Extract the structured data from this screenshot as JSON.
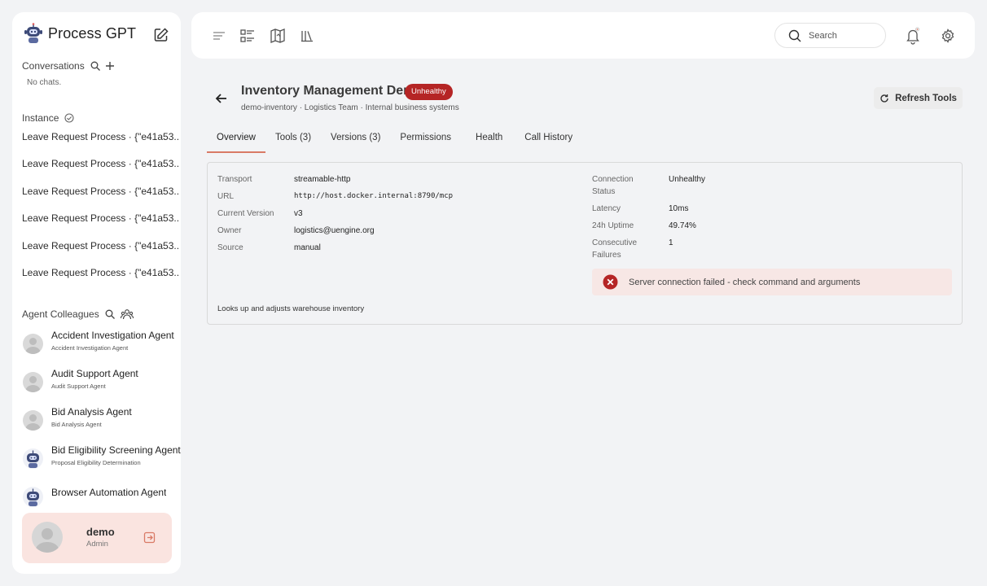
{
  "app": {
    "title": "Process GPT"
  },
  "sidebar": {
    "conversations_label": "Conversations",
    "no_chats": "No chats.",
    "instance_label": "Instance",
    "instances": [
      "Leave Request Process · {\"e41a53...",
      "Leave Request Process · {\"e41a53...",
      "Leave Request Process · {\"e41a53...",
      "Leave Request Process · {\"e41a53...",
      "Leave Request Process · {\"e41a53...",
      "Leave Request Process · {\"e41a53..."
    ],
    "agent_colleagues_label": "Agent Colleagues",
    "agents": [
      {
        "name": "Accident Investigation Agent",
        "sub": "Accident Investigation Agent",
        "avatar": "person"
      },
      {
        "name": "Audit Support Agent",
        "sub": "Audit Support Agent",
        "avatar": "person"
      },
      {
        "name": "Bid Analysis Agent",
        "sub": "Bid Analysis Agent",
        "avatar": "person"
      },
      {
        "name": "Bid Eligibility Screening Agent",
        "sub": "Proposal Eligibility Determination",
        "avatar": "robot"
      },
      {
        "name": "Browser Automation Agent",
        "sub": "",
        "avatar": "robot"
      }
    ],
    "user": {
      "name": "demo",
      "role": "Admin"
    }
  },
  "topbar": {
    "search_placeholder": "Search"
  },
  "server": {
    "name": "Inventory Management Demo",
    "status_badge": "Unhealthy",
    "subline": "demo-inventory · Logistics Team · Internal business systems",
    "refresh_label": "Refresh Tools"
  },
  "tabs": [
    "Overview",
    "Tools (3)",
    "Versions (3)",
    "Permissions",
    "Health",
    "Call History"
  ],
  "overview": {
    "left": [
      {
        "key": "Transport",
        "value": "streamable-http"
      },
      {
        "key": "URL",
        "value": "http://host.docker.internal:8790/mcp"
      },
      {
        "key": "Current Version",
        "value": "v3"
      },
      {
        "key": "Owner",
        "value": "logistics@uengine.org"
      },
      {
        "key": "Source",
        "value": "manual"
      }
    ],
    "right": [
      {
        "key": "Connection Status",
        "value": "Unhealthy"
      },
      {
        "key": "Latency",
        "value": "10ms"
      },
      {
        "key": "24h Uptime",
        "value": "49.74%"
      },
      {
        "key": "Consecutive Failures",
        "value": "1"
      }
    ],
    "description": "Looks up and adjusts warehouse inventory",
    "error_message": "Server connection failed - check command and arguments"
  },
  "colors": {
    "accent": "#d97a66",
    "badge": "#b52525",
    "alert_bg": "#f7e7e5",
    "user_card_bg": "#fae4e0"
  }
}
